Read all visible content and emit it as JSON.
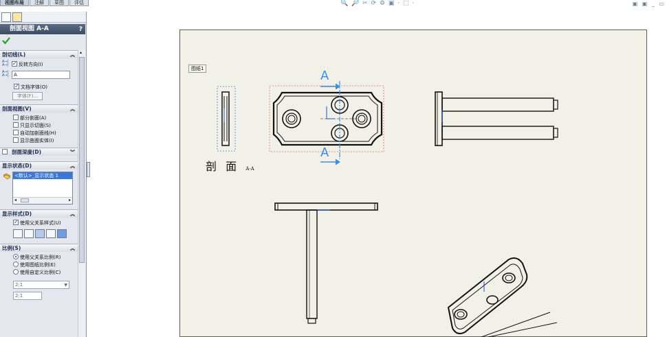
{
  "tabs": [
    "视图布局",
    "注解",
    "草图",
    "评估"
  ],
  "panel": {
    "title": "剖面视图 A-A",
    "help": "?",
    "sections": {
      "cut_line": {
        "header": "剖切线(L)",
        "reverse_direction": "反转方向(I)",
        "label_value": "A",
        "document_font": "文档字体(O)",
        "font_button": "字体(F)..."
      },
      "section_view": {
        "header": "剖面视图(V)",
        "options": [
          "部分剖面(A)",
          "只显示切面(S)",
          "自动加剖面线(H)",
          "显示曲面实体(I)"
        ]
      },
      "section_depth": {
        "header": "剖面深度(D)"
      },
      "display_state": {
        "header": "显示状态(D)",
        "selected_item": "<默认>_显示状态 1"
      },
      "display_style": {
        "header": "显示样式(D)",
        "use_parent": "使用父关系样式(U)"
      },
      "scale": {
        "header": "比例(S)",
        "options": [
          "使用父关系比例(R)",
          "使用图纸比例(E)",
          "使用自定义比例(C)"
        ],
        "custom_value": "2:1",
        "custom_value_2": "2:1"
      }
    }
  },
  "toolbar_icons": "🔍 🔎 ✂ ⟳ ⚙ ▣ · ⬚ ·",
  "window_controls": "▣ ▣ _ ▭",
  "sheet": {
    "label": "图纸1",
    "section_letter_top": "A",
    "section_letter_bottom": "A",
    "caption_main": "剖 面",
    "caption_sub": "A-A"
  },
  "colors": {
    "accent": "#3a8ee6",
    "sheet_bg": "#f2f1e7",
    "selection_dash": "#e07070"
  }
}
